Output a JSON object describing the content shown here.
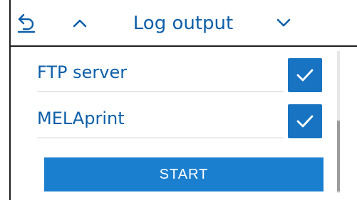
{
  "header": {
    "title": "Log output",
    "back_icon": "back-arrow-icon",
    "up_icon": "chevron-up-icon",
    "down_icon": "chevron-down-icon"
  },
  "options": [
    {
      "label": "FTP server",
      "checked": true
    },
    {
      "label": "MELAprint",
      "checked": true
    }
  ],
  "actions": {
    "start_label": "START"
  },
  "colors": {
    "accent": "#1874c2",
    "text": "#0e5fa8"
  }
}
